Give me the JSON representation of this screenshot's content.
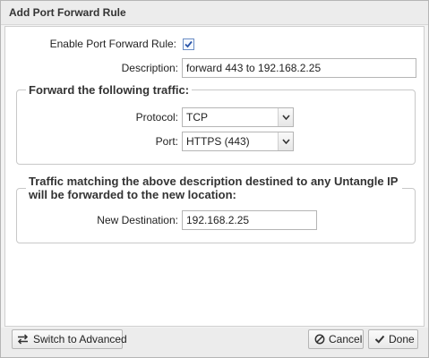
{
  "dialog": {
    "title": "Add Port Forward Rule"
  },
  "form": {
    "enable_label": "Enable Port Forward Rule:",
    "enable_checked": true,
    "description_label": "Description:",
    "description_value": "forward 443 to 192.168.2.25"
  },
  "traffic_group": {
    "legend": "Forward the following traffic:",
    "protocol_label": "Protocol:",
    "protocol_value": "TCP",
    "port_label": "Port:",
    "port_value": "HTTPS (443)"
  },
  "destination_group": {
    "legend_line1": "Traffic matching the above description destined to any Untangle IP",
    "legend_line2": "will be forwarded to the new location:",
    "new_destination_label": "New Destination:",
    "new_destination_value": "192.168.2.25"
  },
  "footer": {
    "advanced_label": "Switch to Advanced",
    "cancel_label": "Cancel",
    "done_label": "Done"
  },
  "icons": {
    "advanced": "switch-arrows-icon",
    "cancel": "cancel-circle-icon",
    "done": "checkmark-icon"
  }
}
